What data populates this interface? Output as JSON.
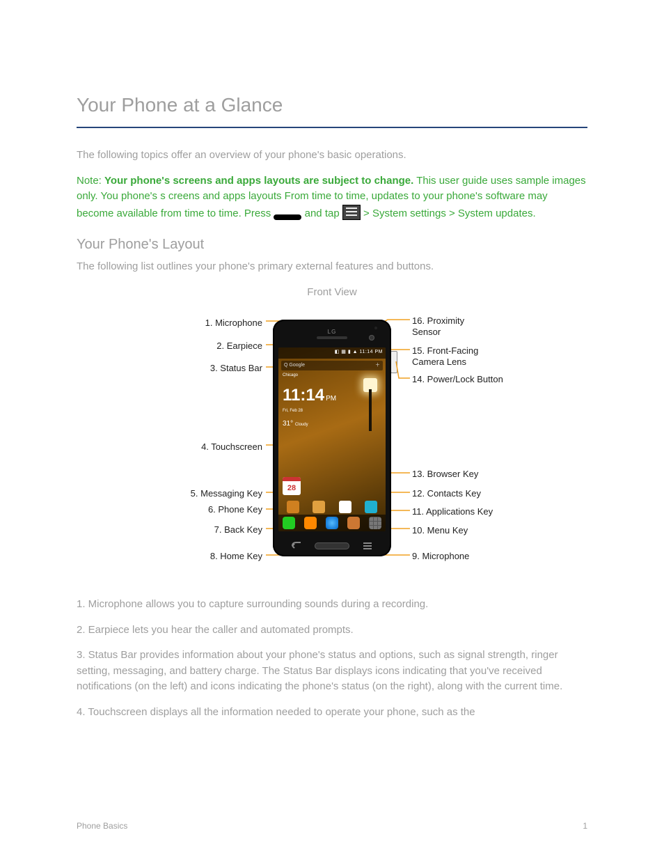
{
  "title": "Your Phone at a Glance",
  "intro": "The following topics offer an overview of your phone's basic operations.",
  "note": {
    "prefix": "Note: ",
    "bold": "Your phone's screens and apps layouts are subject to change.",
    "para1_a": " This user guide uses sample images only. You phone's s",
    "para1_b": "creens and apps layouts ",
    "para2": "From time to time, updates to your phone's software may become available from time to time. Press     and tap     > System settings > System updates.",
    "press_label": "press",
    "tap_label": "tap"
  },
  "diagram_heading": "Your Phone's Layout",
  "diagram_intro": "The following list outlines your phone's primary external features and buttons.",
  "front_view_label": "Front View",
  "labels": {
    "l1": "1. Microphone",
    "l2": "2. Earpiece",
    "l3": "3. Status Bar",
    "l4": "4. Touchscreen",
    "l5": "5. Messaging Key",
    "l6": "6. Phone Key",
    "l7": "7. Back Key",
    "l8": "8. Home Key",
    "r16a": "16. Proximity",
    "r16b": "Sensor",
    "r15a": "15. Front-Facing",
    "r15b": "Camera Lens",
    "r14": "14. Power/Lock Button",
    "r13": "13. Browser Key",
    "r12": "12. Contacts Key",
    "r11": "11. Applications Key",
    "r10": "10. Menu Key",
    "r9": "9. Microphone"
  },
  "phone": {
    "logo": "LG",
    "status_time": "11:14 PM",
    "search": "Q  Google",
    "clock": "11:14",
    "ampm": "PM",
    "date": "Fri, Feb 28",
    "temp": "31°",
    "cond": "Cloudy",
    "city": "Chicago",
    "cal": "28"
  },
  "descriptions": [
    "1. Microphone allows you to capture surrounding sounds during a recording.",
    "2. Earpiece lets you hear the caller and automated prompts.",
    "3. Status Bar provides information about your phone's status and options, such as signal strength, ringer setting, messaging, and battery charge. The Status Bar displays icons indicating that you've received notifications (on the left) and icons indicating the phone's status (on the right), along with the current time.",
    "4. Touchscreen displays all the information needed to operate your phone, such as the"
  ],
  "footer_left": "Phone Basics",
  "footer_right": "1"
}
